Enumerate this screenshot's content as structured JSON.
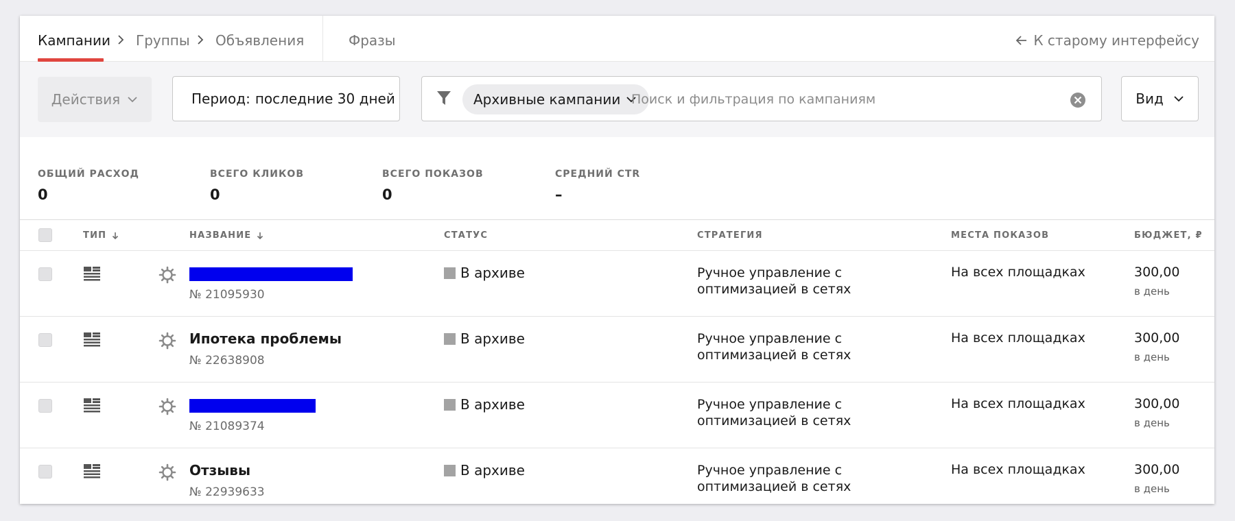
{
  "nav": {
    "tabs": [
      {
        "label": "Кампании",
        "active": true
      },
      {
        "label": "Группы",
        "active": false
      },
      {
        "label": "Объявления",
        "active": false
      },
      {
        "label": "Фразы",
        "active": false
      }
    ],
    "old_interface_link": "К старому интерфейсу"
  },
  "toolbar": {
    "actions_label": "Действия",
    "period_label": "Период:",
    "period_value": "последние 30 дней",
    "filter_chip": "Архивные кампании",
    "search_placeholder": "Поиск и фильтрация по кампаниям",
    "search_value": "",
    "view_label": "Вид"
  },
  "stats": [
    {
      "label": "ОБЩИЙ РАСХОД",
      "value": "0"
    },
    {
      "label": "ВСЕГО КЛИКОВ",
      "value": "0"
    },
    {
      "label": "ВСЕГО ПОКАЗОВ",
      "value": "0"
    },
    {
      "label": "СРЕДНИЙ CTR",
      "value": "–"
    }
  ],
  "table": {
    "columns": {
      "type": "ТИП",
      "name": "НАЗВАНИЕ",
      "status": "СТАТУС",
      "strategy": "СТРАТЕГИЯ",
      "places": "МЕСТА ПОКАЗОВ",
      "budget": "БЮДЖЕТ, ₽"
    },
    "rows": [
      {
        "name": "",
        "name_redacted": true,
        "id": "№ 21095930",
        "status": "В архиве",
        "strategy_line1": "Ручное управление с",
        "strategy_line2": "оптимизацией в сетях",
        "places": "На всех площадках",
        "budget": "300,00",
        "budget_period": "в день"
      },
      {
        "name": "Ипотека проблемы",
        "name_redacted": false,
        "id": "№ 22638908",
        "status": "В архиве",
        "strategy_line1": "Ручное управление с",
        "strategy_line2": "оптимизацией в сетях",
        "places": "На всех площадках",
        "budget": "300,00",
        "budget_period": "в день"
      },
      {
        "name": "",
        "name_redacted": true,
        "id": "№ 21089374",
        "status": "В архиве",
        "strategy_line1": "Ручное управление с",
        "strategy_line2": "оптимизацией в сетях",
        "places": "На всех площадках",
        "budget": "300,00",
        "budget_period": "в день"
      },
      {
        "name": "Отзывы",
        "name_redacted": false,
        "id": "№ 22939633",
        "status": "В архиве",
        "strategy_line1": "Ручное управление с",
        "strategy_line2": "оптимизацией в сетях",
        "places": "На всех площадках",
        "budget": "300,00",
        "budget_period": "в день"
      }
    ]
  },
  "colors": {
    "accent_underline": "#e0463f",
    "redaction": "#0000ee",
    "archived_status": "#a3a3a3"
  },
  "icons": {
    "breadcrumb_separator": "chevron-right-icon",
    "old_interface": "arrow-left-icon",
    "filter": "funnel-icon",
    "clear": "clear-circle-icon",
    "sort": "arrow-down-icon",
    "campaign_type": "text-campaign-icon",
    "settings": "gear-icon"
  }
}
